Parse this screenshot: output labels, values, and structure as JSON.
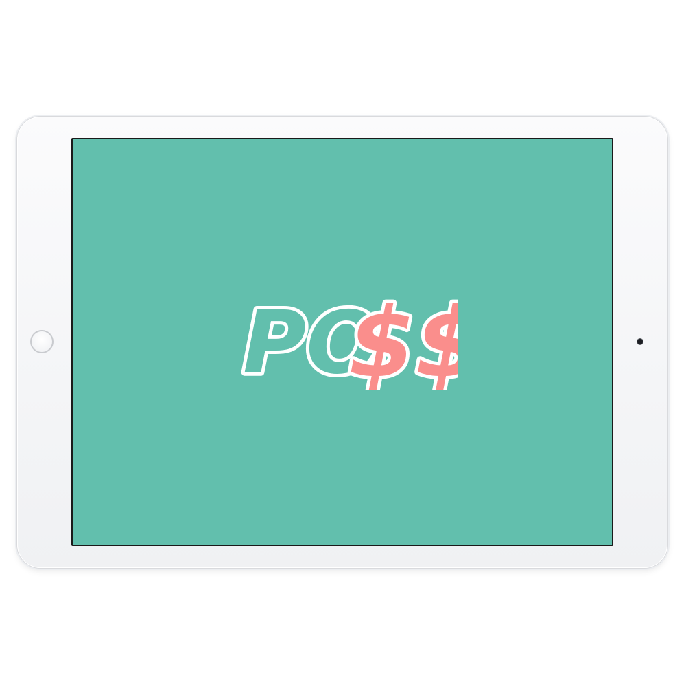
{
  "device": {
    "type": "tablet",
    "frame_color": "#f4f5f7",
    "screen_color": "#62bfad"
  },
  "app": {
    "logo": {
      "text": "PO$$",
      "text_part_1": "PO",
      "text_part_2": "$$",
      "color_part_1": "#62bfad",
      "color_part_2": "#fa8e8c",
      "outline_color": "#ffffff"
    }
  }
}
